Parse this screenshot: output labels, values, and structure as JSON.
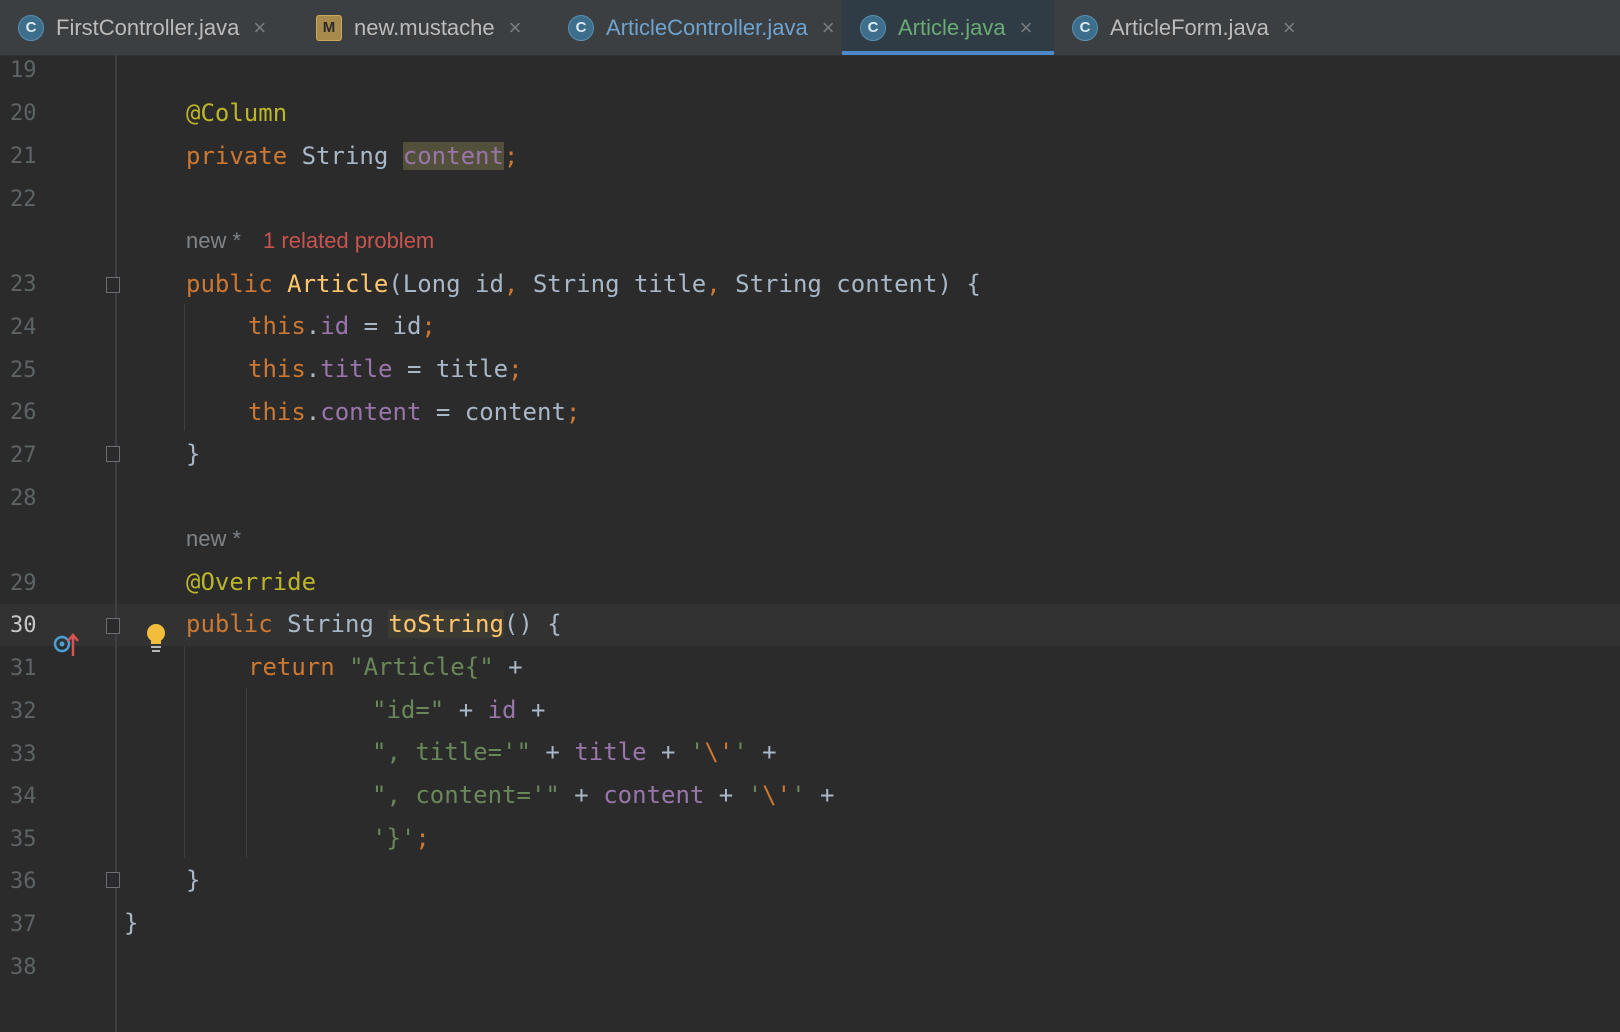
{
  "tabs": [
    {
      "label": "FirstController.java",
      "icon": "class-icon",
      "icon_glyph": "C",
      "active": false
    },
    {
      "label": "new.mustache",
      "icon": "mustache-icon",
      "icon_glyph": "M",
      "active": false
    },
    {
      "label": "ArticleController.java",
      "icon": "class-icon",
      "icon_glyph": "C",
      "active": false
    },
    {
      "label": "Article.java",
      "icon": "class-icon",
      "icon_glyph": "C",
      "active": true
    },
    {
      "label": "ArticleForm.java",
      "icon": "class-icon",
      "icon_glyph": "C",
      "active": false
    }
  ],
  "colors": {
    "background": "#2b2b2b",
    "keyword": "#cc7832",
    "annotation": "#bbb529",
    "function": "#ffc66d",
    "field": "#9876aa",
    "string": "#6a8759",
    "active_tab_text": "#6aab73",
    "active_tab_underline": "#4a88c7",
    "problem": "#c75450"
  },
  "line_numbers": [
    "19",
    "20",
    "21",
    "22",
    "23",
    "24",
    "25",
    "26",
    "27",
    "28",
    "29",
    "30",
    "31",
    "32",
    "33",
    "34",
    "35",
    "36",
    "37",
    "38"
  ],
  "current_line": "30",
  "inlays": {
    "author_1": "new *",
    "problem_1": "1 related problem",
    "author_2": "new *"
  },
  "code": {
    "l20": {
      "annotation": "@Column"
    },
    "l21": {
      "kw": "private",
      "type": "String",
      "name": "content",
      "semi": ";"
    },
    "l23": {
      "kw": "public",
      "ctor": "Article",
      "open": "(",
      "p1type": "Long",
      "p1": "id",
      "comma1": ",",
      "p2type": "String",
      "p2": "title",
      "comma2": ",",
      "p3type": "String",
      "p3": "content",
      "close": ") {"
    },
    "l24": {
      "this": "this",
      "dot": ".",
      "field": "id",
      "rest": " = id",
      "semi": ";"
    },
    "l25": {
      "this": "this",
      "dot": ".",
      "field": "title",
      "rest": " = title",
      "semi": ";"
    },
    "l26": {
      "this": "this",
      "dot": ".",
      "field": "content",
      "rest": " = content",
      "semi": ";"
    },
    "l27": {
      "brace": "}"
    },
    "l29": {
      "annotation": "@Override"
    },
    "l30": {
      "kw": "public",
      "type": "String",
      "method": "toString",
      "rest": "() {"
    },
    "l31": {
      "kw": "return",
      "str": "\"Article{\"",
      "op": " +"
    },
    "l32": {
      "str": "\"id=\"",
      "op1": " + ",
      "field": "id",
      "op2": " +"
    },
    "l33": {
      "str": "\", title='\"",
      "op1": " + ",
      "field": "title",
      "op2": " + ",
      "q1": "'",
      "esc": "\\'",
      "q2": "'",
      "op3": " +"
    },
    "l34": {
      "str": "\", content='\"",
      "op1": " + ",
      "field": "content",
      "op2": " + ",
      "q1": "'",
      "esc": "\\'",
      "q2": "'",
      "op3": " +"
    },
    "l35": {
      "str": "'}'",
      "semi": ";"
    },
    "l36": {
      "brace": "}"
    },
    "l37": {
      "brace": "}"
    }
  }
}
